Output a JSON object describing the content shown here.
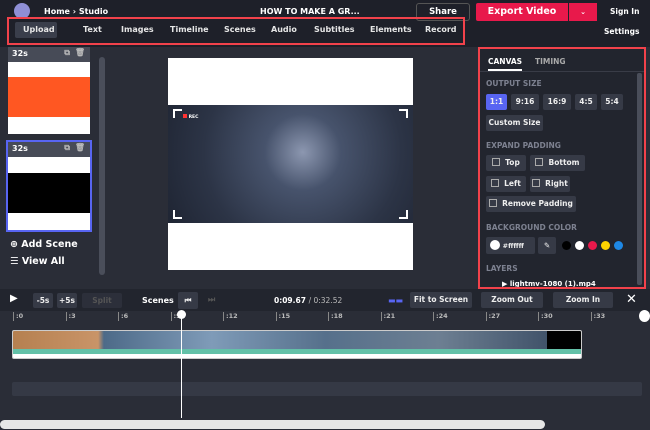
{
  "header": {
    "breadcrumb": "Home › Studio",
    "title": "HOW TO MAKE A GR...",
    "share": "Share",
    "export": "Export Video",
    "sign_in": "Sign In",
    "settings": "Settings"
  },
  "tabs": [
    "Upload",
    "Text",
    "Images",
    "Timeline",
    "Scenes",
    "Audio",
    "Subtitles",
    "Elements",
    "Record"
  ],
  "scenes": [
    {
      "duration": "32s",
      "color": "#ff5722"
    },
    {
      "duration": "32s",
      "color": "#000000"
    }
  ],
  "left": {
    "add_scene": "Add Scene",
    "view_all": "View All"
  },
  "canvas": {
    "rec": "REC"
  },
  "panel": {
    "tabs": [
      "CANVAS",
      "TIMING"
    ],
    "output_size": "OUTPUT SIZE",
    "sizes": [
      "1:1",
      "9:16",
      "16:9",
      "4:5",
      "5:4"
    ],
    "custom": "Custom Size",
    "expand": "EXPAND PADDING",
    "padding": [
      "Top",
      "Bottom",
      "Left",
      "Right",
      "Remove Padding"
    ],
    "bg_label": "BACKGROUND COLOR",
    "bg_value": "#ffffff",
    "swatches": [
      "#000000",
      "#ffffff",
      "#e8194b",
      "#ffd400",
      "#1e88e5"
    ],
    "layers": "LAYERS",
    "layer_name": "lightmv-1080 (1).mp4"
  },
  "timeline": {
    "minus": "-5s",
    "plus": "+5s",
    "split": "Split",
    "scenes": "Scenes",
    "time": "0:09.67",
    "total": "/ 0:32.52",
    "fit": "Fit to Screen",
    "zoom_out": "Zoom Out",
    "zoom_in": "Zoom In",
    "ticks": [
      ":0",
      ":3",
      ":6",
      ":9",
      ":12",
      ":15",
      ":18",
      ":21",
      ":24",
      ":27",
      ":30",
      ":33"
    ]
  },
  "colors": {
    "accent": "#5865f2",
    "export": "#e8194b",
    "highlight": "#f2424b"
  }
}
